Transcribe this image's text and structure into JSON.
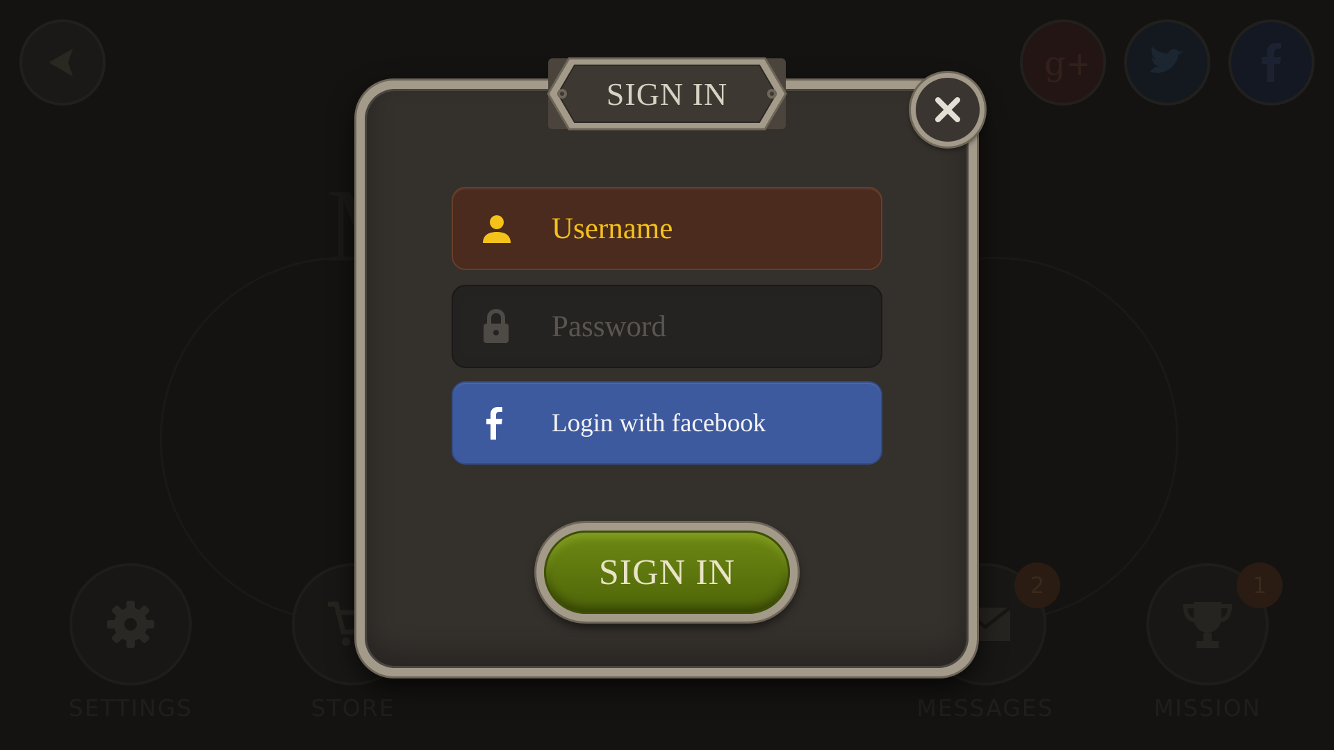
{
  "background": {
    "title_partial": "M                    L",
    "dock": [
      {
        "label": "SETTINGS",
        "icon": "gear-icon"
      },
      {
        "label": "STORE",
        "icon": "cart-icon"
      },
      {
        "label": "MESSAGES",
        "icon": "envelope-icon",
        "badge": "2"
      },
      {
        "label": "MISSION",
        "icon": "trophy-icon",
        "badge": "1"
      }
    ],
    "social": [
      "google-plus-icon",
      "twitter-icon",
      "facebook-icon"
    ],
    "back_icon": "back-arrow-icon"
  },
  "dialog": {
    "title": "SIGN IN",
    "close_icon": "close-icon",
    "username_placeholder": "Username",
    "password_placeholder": "Password",
    "facebook_label": "Login with facebook",
    "submit_label": "SIGN IN"
  },
  "colors": {
    "username_accent": "#f4c21a",
    "facebook_blue": "#3e5a9e",
    "signin_green": "#5f7a0e",
    "frame": "#a39a8a",
    "panel": "#34302c"
  }
}
